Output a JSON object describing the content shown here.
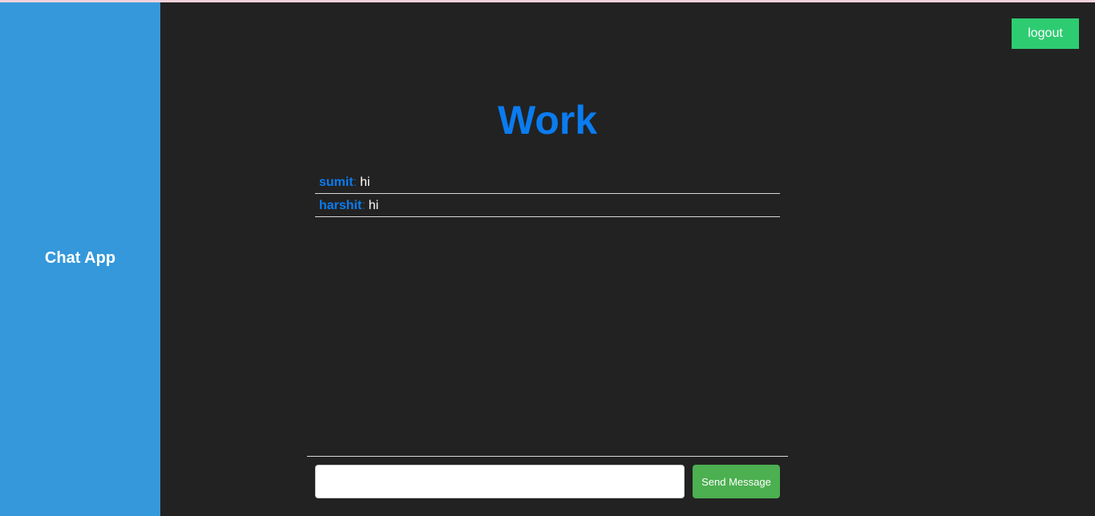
{
  "sidebar": {
    "brand": "Chat App",
    "color": "#3498db"
  },
  "header": {
    "logout_label": "logout",
    "logout_color": "#2ecc71"
  },
  "room": {
    "title": "Work",
    "title_color": "#0a7cf0"
  },
  "messages": [
    {
      "sender": "sumit",
      "separator": ":",
      "text": "hi"
    },
    {
      "sender": "harshit",
      "separator": ":",
      "text": "hi"
    }
  ],
  "composer": {
    "input_value": "",
    "input_placeholder": "",
    "send_label": "Send Message",
    "send_color": "#4caf50"
  }
}
